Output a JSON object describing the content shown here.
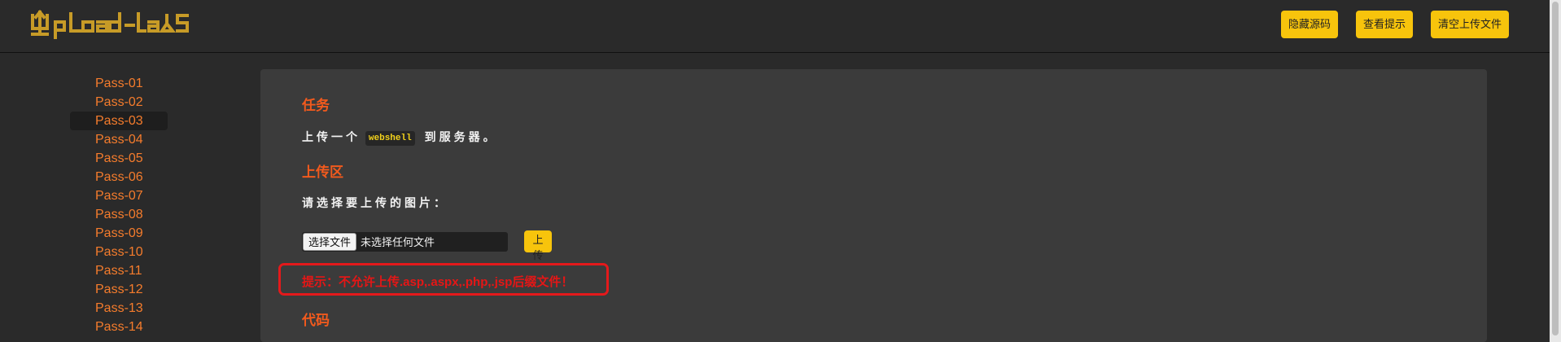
{
  "app": {
    "logo_text": "Upload-labs"
  },
  "header": {
    "buttons": [
      {
        "label": "隐藏源码"
      },
      {
        "label": "查看提示"
      },
      {
        "label": "清空上传文件"
      }
    ]
  },
  "sidebar": {
    "items": [
      {
        "label": "Pass-01"
      },
      {
        "label": "Pass-02"
      },
      {
        "label": "Pass-03",
        "active": true
      },
      {
        "label": "Pass-04"
      },
      {
        "label": "Pass-05"
      },
      {
        "label": "Pass-06"
      },
      {
        "label": "Pass-07"
      },
      {
        "label": "Pass-08"
      },
      {
        "label": "Pass-09"
      },
      {
        "label": "Pass-10"
      },
      {
        "label": "Pass-11"
      },
      {
        "label": "Pass-12"
      },
      {
        "label": "Pass-13"
      },
      {
        "label": "Pass-14"
      }
    ]
  },
  "main": {
    "task_title": "任务",
    "task_prefix": "上传一个",
    "task_code": "webshell",
    "task_suffix": "到服务器。",
    "upload_title": "上传区",
    "upload_prompt": "请选择要上传的图片：",
    "file_button": "选择文件",
    "file_status": "未选择任何文件",
    "upload_button": "上传",
    "hint": "提示：不允许上传.asp,.aspx,.php,.jsp后缀文件！",
    "code_title": "代码"
  },
  "colors": {
    "accent": "#f7c40c",
    "sidebar_link": "#f57c2c",
    "section_title": "#f25a1d",
    "error": "#e51616",
    "panel": "#3b3b3b",
    "background": "#2a2a2a"
  }
}
